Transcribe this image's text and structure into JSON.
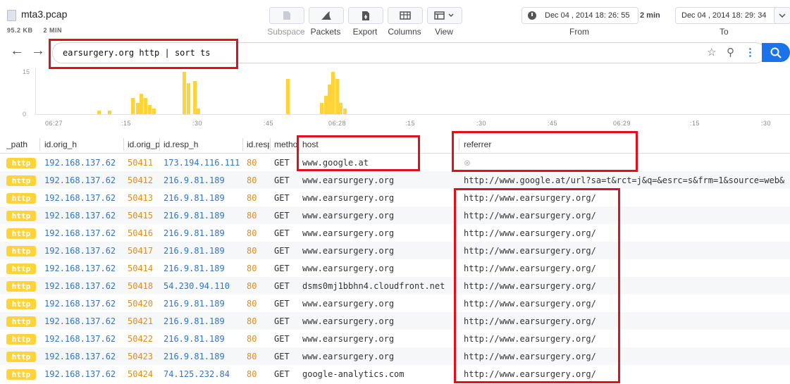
{
  "file": {
    "name": "mta3.pcap",
    "size": "95.2 KB",
    "duration": "2 MIN"
  },
  "toolbar": {
    "subspace": "Subspace",
    "packets": "Packets",
    "export": "Export",
    "columns": "Columns",
    "view": "View"
  },
  "time_range": {
    "from_value": "Dec  04 , 2014  18: 26: 55",
    "duration": "2 min",
    "to_value": "Dec  04 , 2014  18: 29: 34",
    "from_label": "From",
    "to_label": "To"
  },
  "search": {
    "query": "earsurgery.org http | sort ts"
  },
  "histogram": {
    "y_labels": [
      "15",
      "0"
    ],
    "x_ticks": [
      "06:27",
      ":15",
      ":30",
      ":45",
      "06:28",
      ":15",
      ":30",
      ":45",
      "06:29",
      ":15",
      ":30"
    ]
  },
  "table": {
    "columns": [
      "_path",
      "id.orig_h",
      "id.orig_p",
      "id.resp_h",
      "id.resp_p",
      "method",
      "host",
      "referrer"
    ],
    "rows": [
      {
        "path": "http",
        "orig_h": "192.168.137.62",
        "orig_p": "50411",
        "resp_h": "173.194.116.111",
        "resp_p": "80",
        "method": "GET",
        "host": "www.google.at",
        "referrer": ""
      },
      {
        "path": "http",
        "orig_h": "192.168.137.62",
        "orig_p": "50412",
        "resp_h": "216.9.81.189",
        "resp_p": "80",
        "method": "GET",
        "host": "www.earsurgery.org",
        "referrer": "http://www.google.at/url?sa=t&rct=j&q=&esrc=s&frm=1&source=web&"
      },
      {
        "path": "http",
        "orig_h": "192.168.137.62",
        "orig_p": "50413",
        "resp_h": "216.9.81.189",
        "resp_p": "80",
        "method": "GET",
        "host": "www.earsurgery.org",
        "referrer": "http://www.earsurgery.org/"
      },
      {
        "path": "http",
        "orig_h": "192.168.137.62",
        "orig_p": "50415",
        "resp_h": "216.9.81.189",
        "resp_p": "80",
        "method": "GET",
        "host": "www.earsurgery.org",
        "referrer": "http://www.earsurgery.org/"
      },
      {
        "path": "http",
        "orig_h": "192.168.137.62",
        "orig_p": "50416",
        "resp_h": "216.9.81.189",
        "resp_p": "80",
        "method": "GET",
        "host": "www.earsurgery.org",
        "referrer": "http://www.earsurgery.org/"
      },
      {
        "path": "http",
        "orig_h": "192.168.137.62",
        "orig_p": "50417",
        "resp_h": "216.9.81.189",
        "resp_p": "80",
        "method": "GET",
        "host": "www.earsurgery.org",
        "referrer": "http://www.earsurgery.org/"
      },
      {
        "path": "http",
        "orig_h": "192.168.137.62",
        "orig_p": "50414",
        "resp_h": "216.9.81.189",
        "resp_p": "80",
        "method": "GET",
        "host": "www.earsurgery.org",
        "referrer": "http://www.earsurgery.org/"
      },
      {
        "path": "http",
        "orig_h": "192.168.137.62",
        "orig_p": "50418",
        "resp_h": "54.230.94.110",
        "resp_p": "80",
        "method": "GET",
        "host": "dsms0mj1bbhn4.cloudfront.net",
        "referrer": "http://www.earsurgery.org/"
      },
      {
        "path": "http",
        "orig_h": "192.168.137.62",
        "orig_p": "50420",
        "resp_h": "216.9.81.189",
        "resp_p": "80",
        "method": "GET",
        "host": "www.earsurgery.org",
        "referrer": "http://www.earsurgery.org/"
      },
      {
        "path": "http",
        "orig_h": "192.168.137.62",
        "orig_p": "50421",
        "resp_h": "216.9.81.189",
        "resp_p": "80",
        "method": "GET",
        "host": "www.earsurgery.org",
        "referrer": "http://www.earsurgery.org/"
      },
      {
        "path": "http",
        "orig_h": "192.168.137.62",
        "orig_p": "50422",
        "resp_h": "216.9.81.189",
        "resp_p": "80",
        "method": "GET",
        "host": "www.earsurgery.org",
        "referrer": "http://www.earsurgery.org/"
      },
      {
        "path": "http",
        "orig_h": "192.168.137.62",
        "orig_p": "50423",
        "resp_h": "216.9.81.189",
        "resp_p": "80",
        "method": "GET",
        "host": "www.earsurgery.org",
        "referrer": "http://www.earsurgery.org/"
      },
      {
        "path": "http",
        "orig_h": "192.168.137.62",
        "orig_p": "50424",
        "resp_h": "74.125.232.84",
        "resp_p": "80",
        "method": "GET",
        "host": "google-analytics.com",
        "referrer": "http://www.earsurgery.org/"
      }
    ]
  },
  "colors": {
    "accent": "#1a73e8",
    "badge": "#ffd43b",
    "ip": "#2f76c6",
    "port": "#e08e1d",
    "highlight": "#e0101e"
  }
}
